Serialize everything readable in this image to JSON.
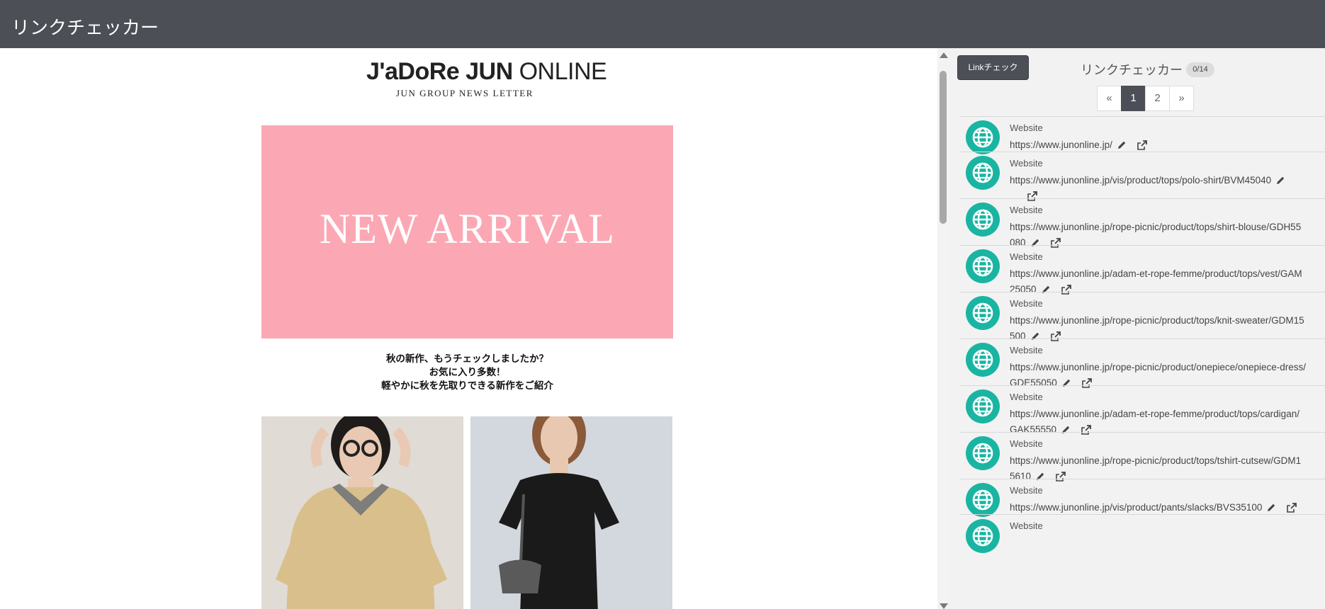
{
  "app": {
    "title": "リンクチェッカー"
  },
  "preview": {
    "logo": {
      "brand": "J'aDoRe JUN",
      "suffix": "ONLINE",
      "tagline": "JUN GROUP NEWS LETTER"
    },
    "hero": {
      "text": "NEW ARRIVAL",
      "color": "#fba8b4"
    },
    "intro_lines": [
      "秋の新作、もうチェックしましたか？",
      "お気に入り多数！",
      "軽やかに秋を先取りできる新作をご紹介"
    ]
  },
  "panel": {
    "check_button": "Linkチェック",
    "title": "リンクチェッカー",
    "count": "0/14",
    "pager": {
      "prev": "«",
      "pages": [
        "1",
        "2"
      ],
      "next": "»",
      "active": "1"
    },
    "items": [
      {
        "label": "Website",
        "url_lines": [
          "https://www.junonline.jp/"
        ]
      },
      {
        "label": "Website",
        "url_lines": [
          "https://www.junonline.jp/vis/product/tops/polo-shirt/BVM45040"
        ]
      },
      {
        "label": "Website",
        "url_lines": [
          "https://www.junonline.jp/rope-picnic/product/tops/shirt-blouse/GDH55",
          "080"
        ]
      },
      {
        "label": "Website",
        "url_lines": [
          "https://www.junonline.jp/adam-et-rope-femme/product/tops/vest/GAM",
          "25050"
        ]
      },
      {
        "label": "Website",
        "url_lines": [
          "https://www.junonline.jp/rope-picnic/product/tops/knit-sweater/GDM15",
          "500"
        ]
      },
      {
        "label": "Website",
        "url_lines": [
          "https://www.junonline.jp/rope-picnic/product/onepiece/onepiece-dress/",
          "GDE55050"
        ]
      },
      {
        "label": "Website",
        "url_lines": [
          "https://www.junonline.jp/adam-et-rope-femme/product/tops/cardigan/",
          "GAK55550"
        ]
      },
      {
        "label": "Website",
        "url_lines": [
          "https://www.junonline.jp/rope-picnic/product/tops/tshirt-cutsew/GDM1",
          "5610"
        ]
      },
      {
        "label": "Website",
        "url_lines": [
          "https://www.junonline.jp/vis/product/pants/slacks/BVS35100"
        ]
      },
      {
        "label": "Website",
        "url_lines": []
      }
    ],
    "accent_color": "#1ab5a2"
  }
}
